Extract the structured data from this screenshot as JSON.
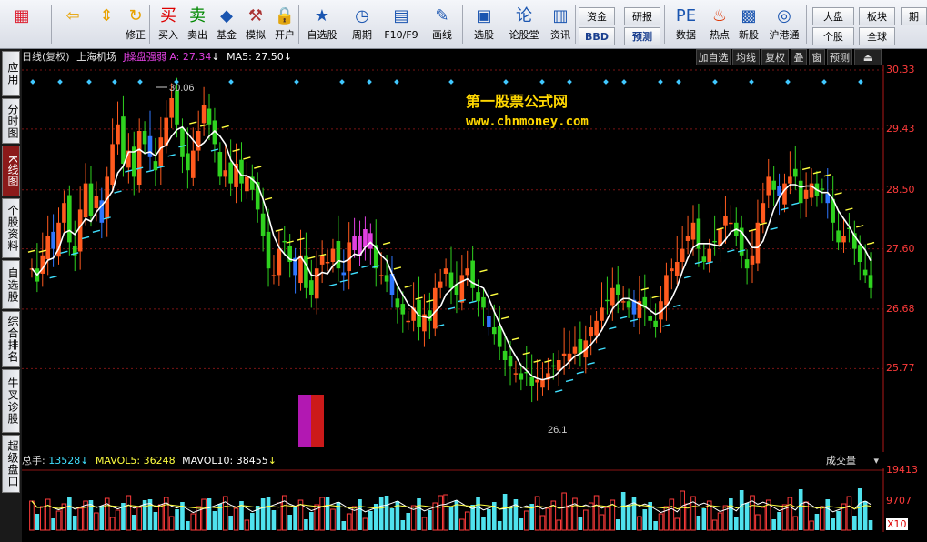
{
  "toolbar": {
    "items": [
      {
        "icon": "windows-icon",
        "label": ""
      },
      {
        "icon": "back-arrow-icon",
        "label": ""
      },
      {
        "icon": "up-down-icon",
        "label": ""
      },
      {
        "icon": "fix-icon",
        "label": "修正"
      },
      {
        "icon": "buy-icon",
        "label": "买入"
      },
      {
        "icon": "sell-icon",
        "label": "卖出"
      },
      {
        "icon": "fund-icon",
        "label": "基金"
      },
      {
        "icon": "hammer-icon",
        "label": "模拟"
      },
      {
        "icon": "lock-icon",
        "label": "开户"
      },
      {
        "icon": "star-icon",
        "label": "自选股"
      },
      {
        "icon": "clock-icon",
        "label": "周期"
      },
      {
        "icon": "f10-icon",
        "label": "F10/F9"
      },
      {
        "icon": "pen-icon",
        "label": "画线"
      },
      {
        "icon": "chart-icon",
        "label": "选股"
      },
      {
        "icon": "forum-icon",
        "label": "论股堂"
      },
      {
        "icon": "news-icon",
        "label": "资讯"
      },
      {
        "icon": "pe-icon",
        "label": "数据"
      },
      {
        "icon": "hot-icon",
        "label": "热点"
      },
      {
        "icon": "new-stock-icon",
        "label": "新股"
      },
      {
        "icon": "hk-icon",
        "label": "沪港通"
      }
    ],
    "small_buttons": [
      "资金",
      "BBD",
      "研报",
      "预测",
      "大盘",
      "个股",
      "板块",
      "全球",
      "期"
    ]
  },
  "left_nav": [
    "应用",
    "分时图",
    "K线图",
    "个股资料",
    "自选股",
    "综合排名",
    "牛叉诊股",
    "超级盘口"
  ],
  "chart_info": {
    "period": "日线(复权)",
    "stock": "上海机场",
    "indicator_name": "J操盘强弱",
    "indicator_value": "A: 27.34",
    "ma_value": "MA5: 27.50",
    "arrow": "↓"
  },
  "right_toolbar": [
    "加自选",
    "均线",
    "复权",
    "叠",
    "窗",
    "预测",
    "⏏"
  ],
  "price_axis": [
    "30.33",
    "29.43",
    "28.50",
    "27.60",
    "26.68",
    "25.77"
  ],
  "annotations": {
    "high": "30.06",
    "low": "26.1"
  },
  "watermark": {
    "line1": "第一股票公式网",
    "line2": "www.chnmoney.com"
  },
  "volume": {
    "label_total": "总手:",
    "total_value": "13528",
    "mavol5_label": "MAVOL5:",
    "mavol5_value": "36248",
    "mavol10_label": "MAVOL10:",
    "mavol10_value": "38455",
    "dropdown": "成交量",
    "axis": [
      "19413",
      "9707",
      "X10"
    ]
  },
  "colors": {
    "up": "#ff5a1e",
    "down": "#2fd21f",
    "blue_down": "#2f77ff",
    "magenta": "#e040e0",
    "ma": "#ffffff",
    "cyan_sig": "#40e0ff",
    "yellow_sig": "#ffff40",
    "vol_up": "#ff3b3b",
    "vol_down": "#4fe2ee"
  },
  "chart_data": {
    "type": "candlestick",
    "ylim": [
      25.4,
      30.4
    ],
    "closes": [
      27.3,
      27.1,
      27.5,
      27.8,
      27.6,
      28.0,
      28.3,
      27.7,
      27.5,
      28.2,
      28.6,
      28.1,
      28.4,
      28.0,
      28.7,
      29.2,
      29.5,
      28.9,
      29.1,
      28.7,
      29.4,
      29.2,
      29.0,
      28.8,
      29.3,
      29.6,
      29.9,
      29.5,
      29.0,
      28.8,
      29.1,
      29.4,
      29.8,
      29.5,
      29.2,
      28.7,
      28.8,
      28.6,
      28.9,
      28.6,
      28.7,
      28.5,
      28.2,
      27.8,
      27.3,
      27.2,
      27.6,
      27.7,
      27.4,
      27.2,
      27.5,
      27.0,
      26.9,
      27.3,
      27.5,
      27.4,
      27.6,
      27.3,
      27.2,
      27.7,
      27.8,
      27.5,
      27.9,
      27.6,
      27.3,
      27.2,
      27.1,
      26.9,
      26.7,
      26.6,
      26.5,
      26.7,
      26.4,
      26.6,
      26.5,
      27.0,
      27.1,
      27.3,
      27.0,
      26.9,
      27.2,
      27.3,
      27.0,
      26.8,
      26.7,
      26.4,
      26.3,
      26.1,
      25.9,
      25.8,
      25.7,
      25.6,
      25.7,
      25.5,
      25.6,
      25.6,
      25.7,
      25.8,
      25.9,
      26.0,
      26.0,
      26.1,
      26.0,
      26.2,
      26.4,
      26.5,
      26.7,
      26.8,
      27.0,
      26.9,
      26.8,
      26.7,
      26.6,
      26.8,
      26.7,
      26.5,
      26.4,
      26.8,
      27.2,
      27.3,
      27.4,
      27.6,
      27.8,
      28.0,
      27.6,
      27.4,
      27.6,
      27.7,
      27.9,
      28.1,
      28.0,
      27.8,
      27.5,
      27.3,
      27.5,
      28.0,
      28.3,
      28.7,
      28.5,
      28.4,
      28.6,
      28.7,
      28.7,
      28.3,
      28.5,
      28.6,
      28.4,
      28.5,
      28.3,
      28.0,
      27.7,
      27.8,
      27.9,
      27.6,
      27.4,
      27.2,
      27.0
    ]
  }
}
